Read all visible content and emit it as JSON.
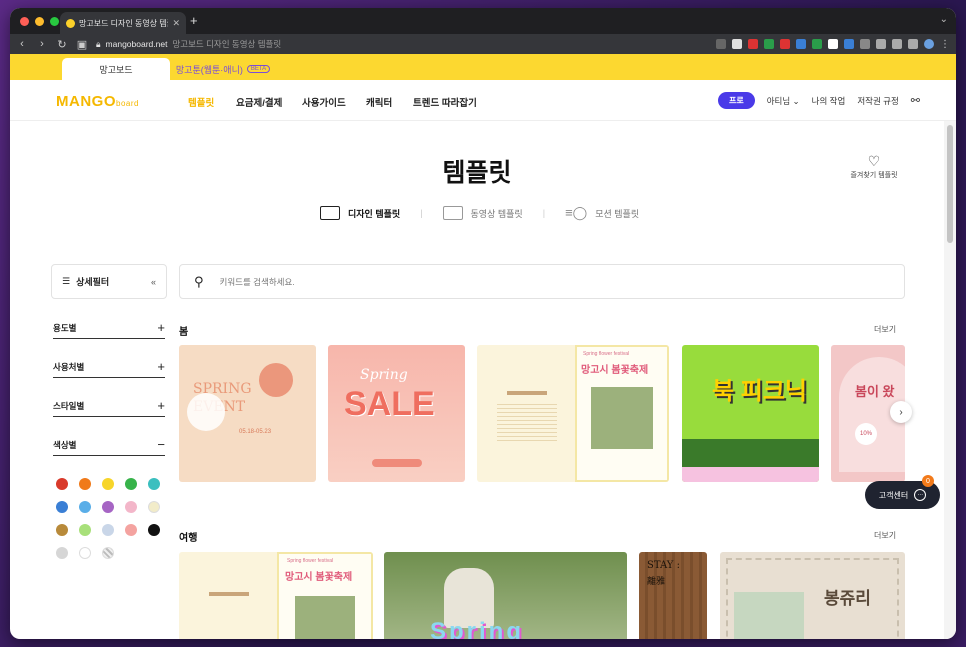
{
  "browser": {
    "tab_title": "망고보드 디자인 동영상 템플릿",
    "url_host": "mangoboard.net",
    "url_rest": "망고보드 디자인 동영상 템플릿"
  },
  "site_tabs": {
    "active": "망고보드",
    "other": "망고툰(웹툰·애니)",
    "badge": "BETA"
  },
  "nav": {
    "logo_main": "MANGO",
    "logo_sub": "board",
    "items": [
      "템플릿",
      "요금제/결제",
      "사용가이드",
      "캐릭터",
      "트렌드 따라잡기"
    ],
    "pro_label": "프로",
    "user": "아티님",
    "my_work": "나의 작업",
    "copyright": "저작권 규정"
  },
  "page": {
    "title": "템플릿",
    "favorites_label": "즐겨찾기 템플릿",
    "type_tabs": [
      "디자인 템플릿",
      "동영상 템플릿",
      "모션 템플릿"
    ]
  },
  "sidebar": {
    "filter_label": "상세필터",
    "sections": [
      {
        "label": "용도별",
        "sign": "+"
      },
      {
        "label": "사용처별",
        "sign": "+"
      },
      {
        "label": "스타일별",
        "sign": "+"
      },
      {
        "label": "색상별",
        "sign": "−"
      }
    ],
    "colors": [
      "#d93a2b",
      "#f07a1a",
      "#f7d52a",
      "#37b34a",
      "#3bbfbf",
      "#3a7fd5",
      "#5aaee8",
      "#a665c4",
      "#f3b6c9",
      "#f2ecc9",
      "#b88a3a",
      "#a8e07a",
      "#c9d6e8",
      "#f4a3a0",
      "#111111",
      "#d6d6d6",
      "#ffffff",
      "#e0e0e0"
    ]
  },
  "search": {
    "placeholder": "키워드를 검색하세요."
  },
  "sections": [
    {
      "title": "봄",
      "more": "더보기",
      "cards": [
        {
          "name": "spring-event",
          "text_main": "SPRING EVENT",
          "text_sub": "05.18-05.23",
          "bg": "#f6dcc4"
        },
        {
          "name": "spring-sale",
          "text_main": "SALE",
          "text_sub": "Spring",
          "bg": "#f7b6ab"
        },
        {
          "name": "flower-festival",
          "text_main": "망고시 봄꽃축제",
          "text_sub": "Spring flower festival",
          "bg": "#fbf4dc"
        },
        {
          "name": "book-picnic",
          "text_main": "북 피크닉",
          "text_sub": "",
          "bg": "#98dc3c"
        },
        {
          "name": "spring-partial",
          "text_main": "봄이 왔",
          "text_sub": "10%",
          "bg": "#f3c7c7"
        }
      ]
    },
    {
      "title": "여행",
      "more": "더보기",
      "cards": [
        {
          "name": "travel-festival",
          "text_main": "망고시 봄꽃축제",
          "text_sub": "Spring flower festival",
          "bg": "#fbf4dc"
        },
        {
          "name": "travel-spring-photo",
          "text_main": "Spring",
          "text_sub": "",
          "bg": "#7a9a5a"
        },
        {
          "name": "travel-stay",
          "text_main": "STAY :",
          "text_sub": "離雅",
          "bg": "#8a5a35"
        },
        {
          "name": "travel-bong",
          "text_main": "봉쥬리",
          "text_sub": "",
          "bg": "#e8dfd2"
        }
      ]
    }
  ],
  "support": {
    "label": "고객센터",
    "badge": "0"
  },
  "colors": {
    "brand_yellow": "#fcd830",
    "pro_purple": "#4a3ae8",
    "nav_active": "#f5b800"
  }
}
